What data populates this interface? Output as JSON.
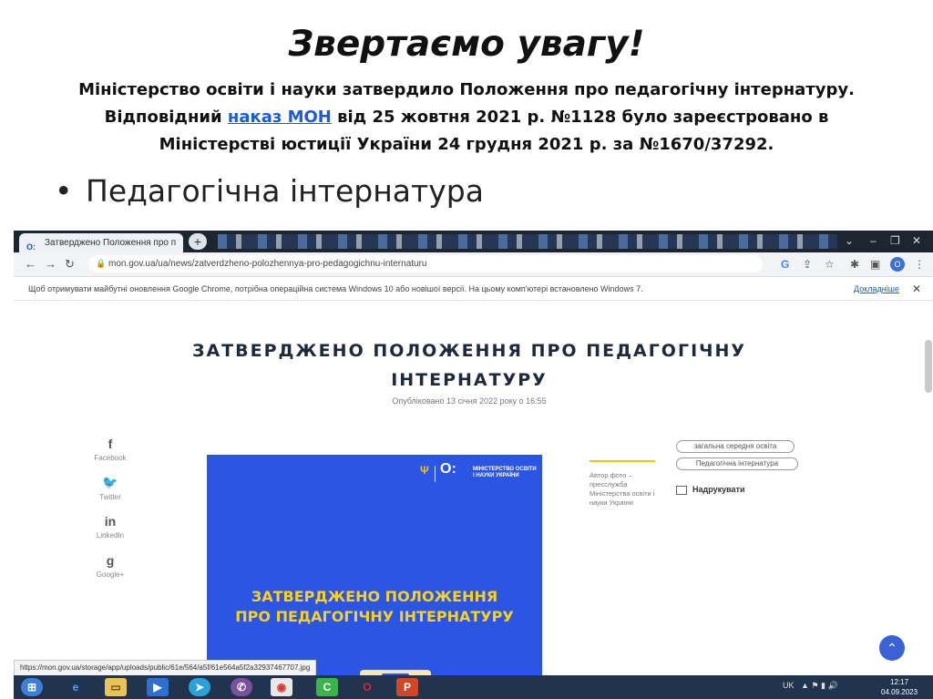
{
  "slide": {
    "title": "Звертаємо увагу!",
    "notice_line1": "Міністерство освіти і науки затвердило Положення про педагогічну інтернатуру.",
    "notice_line2_before": "Відповідний ",
    "notice_link": "наказ МОН",
    "notice_line2_after": " від 25 жовтня 2021 р. №1128 було зареєстровано в",
    "notice_line3": "Міністерстві юстиції України 24 грудня 2021 р. за №1670/37292.",
    "bullet_symbol": "•",
    "bullet_text": "Педагогічна інтернатура"
  },
  "browser": {
    "tab_favicon": "O:",
    "tab_title": "Затверджено Положення про п",
    "tab_close": "×",
    "new_tab": "+",
    "url": "mon.gov.ua/ua/news/zatverdzheno-polozhennya-pro-pedagogichnu-internaturu",
    "profile_initial": "O",
    "infobar_text": "Щоб отримувати майбутні оновлення Google Chrome, потрібна операційна система Windows 10 або новішої версії. На цьому комп'ютері встановлено Windows 7.",
    "infobar_link": "Докладніше",
    "status_url": "https://mon.gov.ua/storage/app/uploads/public/61e/564/a5f/61e564a5f2a32937467707.jpg"
  },
  "article": {
    "heading_line1": "ЗАТВЕРДЖЕНО ПОЛОЖЕННЯ ПРО ПЕДАГОГІЧНУ",
    "heading_line2": "ІНТЕРНАТУРУ",
    "published": "Опубліковано 13 січня 2022 року о 16:55",
    "share": [
      {
        "icon": "f",
        "label": "Facebook"
      },
      {
        "icon": "🐦",
        "label": "Twitter"
      },
      {
        "icon": "in",
        "label": "LinkedIn"
      },
      {
        "icon": "g",
        "label": "Google+"
      }
    ],
    "image_logo_text": "МІНІСТЕРСТВО ОСВІТИ І НАУКИ УКРАЇНИ",
    "image_title_line1": "ЗАТВЕРДЖЕНО ПОЛОЖЕННЯ",
    "image_title_line2": "ПРО ПЕДАГОГІЧНУ ІНТЕРНАТУРУ",
    "photo_credit": "Автор фото – пресслужба Міністерства освіти і науки України",
    "tags": [
      "загальна середня освіта",
      "Педагогічна інтернатура"
    ],
    "print_label": "Надрукувати"
  },
  "taskbar": {
    "language": "UK",
    "time": "12:17",
    "date": "04.09.2023"
  },
  "colors": {
    "brand_blue": "#2b55e3",
    "brand_yellow": "#f8d21b",
    "link": "#1a5bd6"
  }
}
